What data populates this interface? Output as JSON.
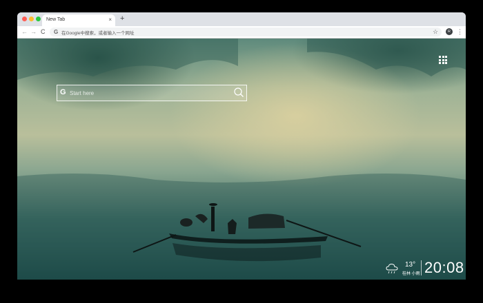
{
  "browser": {
    "tab": {
      "title": "New Tab",
      "close": "×"
    },
    "new_tab": "+",
    "nav": {
      "back": "←",
      "forward": "→",
      "reload": "C"
    },
    "omnibox": {
      "g_icon": "G",
      "placeholder": "在Google中搜索，或者输入一个网址"
    },
    "bookmark_star": "☆",
    "profile_initial": "R",
    "menu": "⋮"
  },
  "newtab": {
    "search": {
      "g_icon": "G",
      "placeholder": "Start here"
    },
    "apps_icon": "apps-grid-icon",
    "weather": {
      "temperature": "13°",
      "condition": "桂林 小雨",
      "icon": "cloud-rain-icon"
    },
    "clock": "20:08"
  },
  "colors": {
    "accent_red": "#ff5f57",
    "accent_yellow": "#febc2e",
    "accent_green": "#28c840"
  }
}
